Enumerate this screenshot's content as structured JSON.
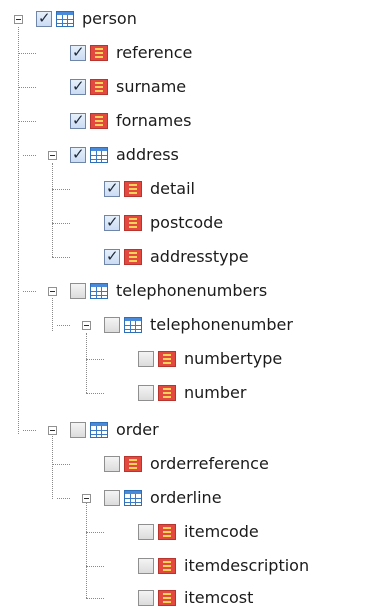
{
  "tree": {
    "nodes": [
      {
        "label": "person",
        "checked": true,
        "type": "table"
      },
      {
        "label": "reference",
        "checked": true,
        "type": "field"
      },
      {
        "label": "surname",
        "checked": true,
        "type": "field"
      },
      {
        "label": "fornames",
        "checked": true,
        "type": "field"
      },
      {
        "label": "address",
        "checked": true,
        "type": "table"
      },
      {
        "label": "detail",
        "checked": true,
        "type": "field"
      },
      {
        "label": "postcode",
        "checked": true,
        "type": "field"
      },
      {
        "label": "addresstype",
        "checked": true,
        "type": "field"
      },
      {
        "label": "telephonenumbers",
        "checked": false,
        "type": "table"
      },
      {
        "label": "telephonenumber",
        "checked": false,
        "type": "table"
      },
      {
        "label": "numbertype",
        "checked": false,
        "type": "field"
      },
      {
        "label": "number",
        "checked": false,
        "type": "field"
      },
      {
        "label": "order",
        "checked": false,
        "type": "table"
      },
      {
        "label": "orderreference",
        "checked": false,
        "type": "field"
      },
      {
        "label": "orderline",
        "checked": false,
        "type": "table"
      },
      {
        "label": "itemcode",
        "checked": false,
        "type": "field"
      },
      {
        "label": "itemdescription",
        "checked": false,
        "type": "field"
      },
      {
        "label": "itemcost",
        "checked": false,
        "type": "field"
      }
    ]
  }
}
